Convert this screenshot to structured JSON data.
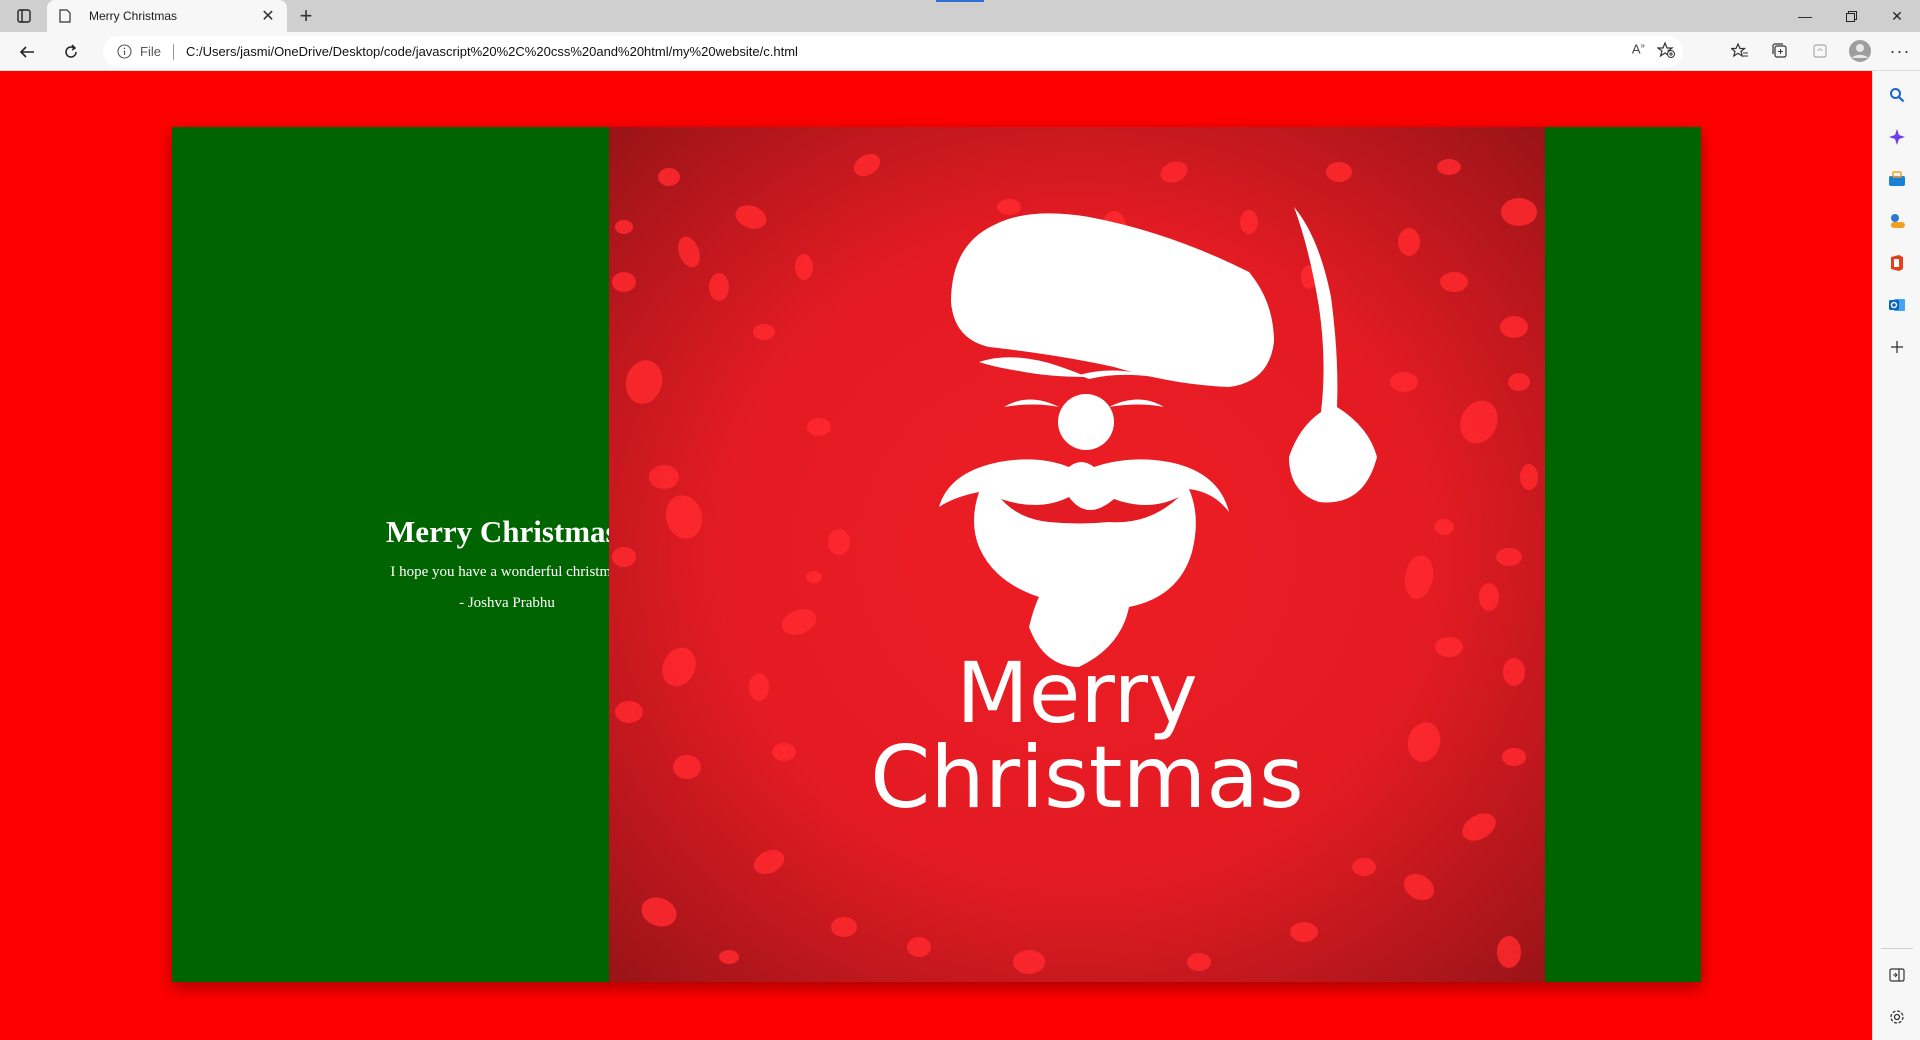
{
  "browser": {
    "tab": {
      "title": "Merry Christmas"
    },
    "address": {
      "site_info_label": "File",
      "url": "C:/Users/jasmi/OneDrive/Desktop/code/javascript%20%2C%20css%20and%20html/my%20website/c.html"
    }
  },
  "page": {
    "card_heading": "Merry Christmas!",
    "card_message": "I hope you have a wonderful christmas",
    "card_author": "- Joshva Prabhu",
    "poster_line1": "Merry",
    "poster_line2": "Christmas",
    "colors": {
      "page_background": "#ff0000",
      "card_green": "#006400",
      "poster_red": "#e31b23"
    }
  },
  "icons": {
    "sidebar": [
      "search-icon",
      "copilot-icon",
      "shopping-icon",
      "games-icon",
      "office-icon",
      "outlook-icon",
      "add-icon",
      "split-screen-icon",
      "settings-icon"
    ],
    "toolbar": [
      "read-aloud-icon",
      "add-favorite-icon",
      "favorites-icon",
      "collections-icon",
      "extensions-icon",
      "profile-icon",
      "more-icon"
    ]
  }
}
